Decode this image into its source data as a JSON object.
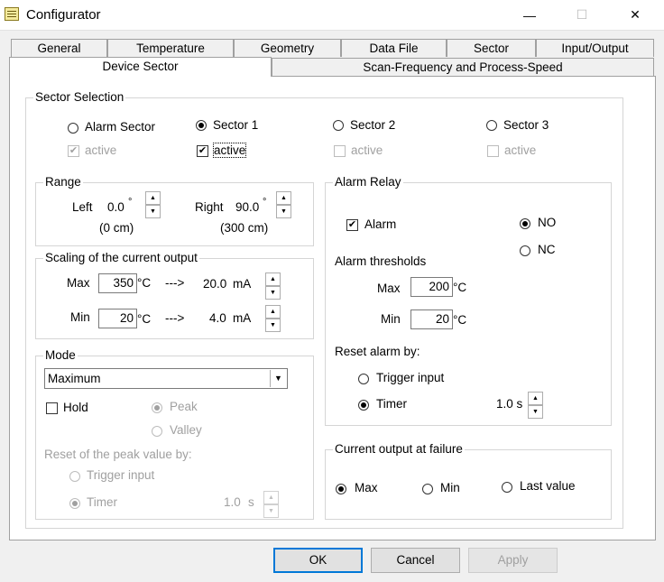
{
  "window": {
    "title": "Configurator",
    "minimize": "—",
    "maximize": "☐",
    "close": "✕"
  },
  "tabs_row1": [
    "General",
    "Temperature",
    "Geometry",
    "Data File",
    "Sector",
    "Input/Output"
  ],
  "tabs_row2": [
    "Device Sector",
    "Scan-Frequency and Process-Speed"
  ],
  "sector_selection": {
    "title": "Sector Selection",
    "options": [
      "Alarm Sector",
      "Sector 1",
      "Sector 2",
      "Sector 3"
    ],
    "selected": "Sector 1",
    "active_label": "active"
  },
  "range": {
    "title": "Range",
    "left_label": "Left",
    "left_value": "0.0",
    "left_unit": "°",
    "left_cm": "(0 cm)",
    "right_label": "Right",
    "right_value": "90.0",
    "right_unit": "°",
    "right_cm": "(300 cm)"
  },
  "scaling": {
    "title": "Scaling of the current output",
    "max_label": "Max",
    "max_value": "350",
    "max_unit": "°C",
    "max_arrow": "--->",
    "max_ma": "20.0",
    "max_ma_unit": "mA",
    "min_label": "Min",
    "min_value": "20",
    "min_unit": "°C",
    "min_arrow": "--->",
    "min_ma": "4.0",
    "min_ma_unit": "mA"
  },
  "mode": {
    "title": "Mode",
    "select_value": "Maximum",
    "hold_label": "Hold",
    "peak_label": "Peak",
    "valley_label": "Valley",
    "reset_label": "Reset of the peak value by:",
    "trigger_label": "Trigger input",
    "timer_label": "Timer",
    "timer_value": "1.0",
    "timer_unit": "s"
  },
  "alarm_relay": {
    "title": "Alarm Relay",
    "alarm_label": "Alarm",
    "no_label": "NO",
    "nc_label": "NC",
    "thresholds_label": "Alarm thresholds",
    "max_label": "Max",
    "max_value": "200",
    "max_unit": "°C",
    "min_label": "Min",
    "min_value": "20",
    "min_unit": "°C",
    "reset_label": "Reset alarm by:",
    "trigger_label": "Trigger input",
    "timer_label": "Timer",
    "timer_value": "1.0 s"
  },
  "failure": {
    "title": "Current output at failure",
    "max_label": "Max",
    "min_label": "Min",
    "last_label": "Last value"
  },
  "buttons": {
    "ok": "OK",
    "cancel": "Cancel",
    "apply": "Apply"
  },
  "icons": {
    "spin_up": "▲",
    "spin_down": "▼",
    "dropdown": "▼",
    "check": "✔"
  }
}
